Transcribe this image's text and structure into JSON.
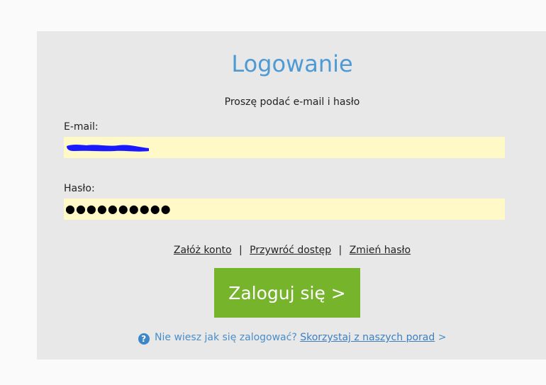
{
  "title": "Logowanie",
  "subtitle": "Proszę podać e-mail i hasło",
  "email": {
    "label": "E-mail:"
  },
  "password": {
    "label": "Hasło:",
    "masked_value": "●●●●●●●●●●"
  },
  "links": {
    "create_account": "Załóż konto",
    "separator1": "|",
    "restore_access": "Przywróć dostęp",
    "separator2": "|",
    "change_password": "Zmień hasło"
  },
  "login_button": "Zaloguj się >",
  "help": {
    "icon": "question-icon",
    "icon_glyph": "?",
    "text": "Nie wiesz jak się zalogować?",
    "link": "Skorzystaj z naszych porad",
    "suffix": ">"
  },
  "colors": {
    "title": "#4e9ad4",
    "button": "#76b42b",
    "field_bg": "#fff9c8",
    "panel_bg": "#e8e8e8",
    "redaction": "#1a1aff"
  }
}
